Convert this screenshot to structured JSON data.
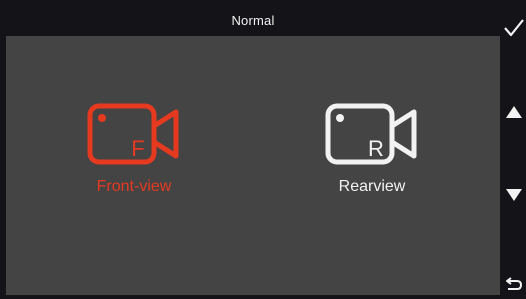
{
  "header": {
    "title": "Normal"
  },
  "cameras": {
    "front": {
      "letter": "F",
      "label": "Front-view",
      "color": "#e53a20",
      "selected": true
    },
    "rear": {
      "letter": "R",
      "label": "Rearview",
      "color": "#f2f2f2",
      "selected": false
    }
  },
  "side_buttons": {
    "ok_icon": "checkmark-icon",
    "up_icon": "triangle-up-icon",
    "down_icon": "triangle-down-icon",
    "back_icon": "return-arrow-icon"
  }
}
